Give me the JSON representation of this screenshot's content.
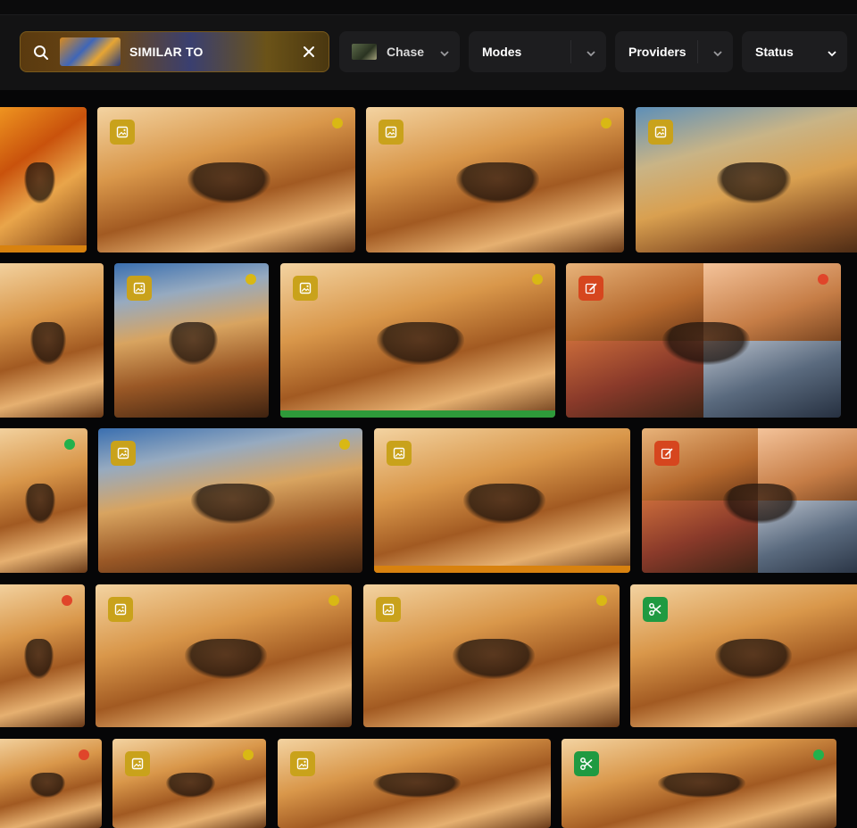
{
  "toolbar": {
    "search": {
      "label": "SIMILAR TO"
    },
    "filters": [
      {
        "label": "Chase"
      },
      {
        "label": "Modes"
      },
      {
        "label": "Providers"
      },
      {
        "label": "Status"
      }
    ]
  },
  "colors": {
    "image_badge": "#c9a21b",
    "edit_badge": "#d6461e",
    "cut_badge": "#1f9a41",
    "dot_yellow": "#d9b814",
    "dot_green": "#22b14c",
    "dot_red": "#e0452a",
    "bar_orange": "#d8820f",
    "bar_green": "#2e9a3a"
  },
  "gallery": [
    {
      "badge": "none",
      "status": "none",
      "bar": "orange",
      "tone": "fire"
    },
    {
      "badge": "image",
      "status": "yellow",
      "bar": "none",
      "tone": "sand"
    },
    {
      "badge": "image",
      "status": "yellow",
      "bar": "none",
      "tone": "sand"
    },
    {
      "badge": "image",
      "status": "none",
      "bar": "none",
      "tone": "dusk"
    },
    {
      "badge": "none",
      "status": "none",
      "bar": "none",
      "tone": "sand"
    },
    {
      "badge": "image",
      "status": "yellow",
      "bar": "none",
      "tone": "sky"
    },
    {
      "badge": "image",
      "status": "yellow",
      "bar": "green",
      "tone": "sand"
    },
    {
      "badge": "edit",
      "status": "red",
      "bar": "none",
      "tone": "grid"
    },
    {
      "badge": "none",
      "status": "green",
      "bar": "none",
      "tone": "sand"
    },
    {
      "badge": "image",
      "status": "yellow",
      "bar": "none",
      "tone": "sky"
    },
    {
      "badge": "image",
      "status": "none",
      "bar": "orange",
      "tone": "sand"
    },
    {
      "badge": "edit",
      "status": "none",
      "bar": "none",
      "tone": "grid"
    },
    {
      "badge": "none",
      "status": "red",
      "bar": "none",
      "tone": "sand"
    },
    {
      "badge": "image",
      "status": "yellow",
      "bar": "none",
      "tone": "sand"
    },
    {
      "badge": "image",
      "status": "yellow",
      "bar": "none",
      "tone": "sand"
    },
    {
      "badge": "cut",
      "status": "none",
      "bar": "none",
      "tone": "sand"
    },
    {
      "badge": "none",
      "status": "red",
      "bar": "none",
      "tone": "sand"
    },
    {
      "badge": "image",
      "status": "yellow",
      "bar": "none",
      "tone": "sand"
    },
    {
      "badge": "image",
      "status": "none",
      "bar": "none",
      "tone": "sand"
    },
    {
      "badge": "cut",
      "status": "green",
      "bar": "none",
      "tone": "sand"
    }
  ]
}
